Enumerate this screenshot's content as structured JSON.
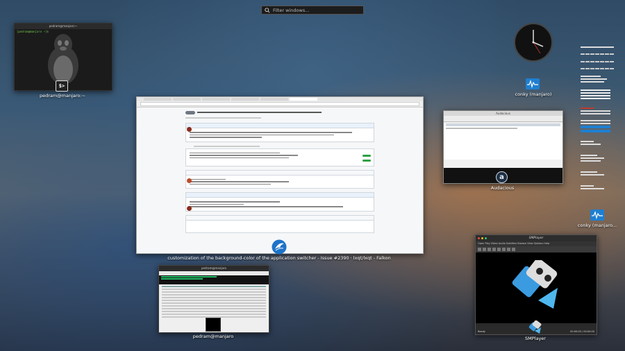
{
  "search": {
    "placeholder": "Filter windows..."
  },
  "windows": {
    "terminal_top": {
      "title": "pedram@manjaro:~",
      "prompt": "[pedram@manjaro ~]$",
      "caption": "pedram@manjaro:~",
      "icon": "terminal-icon"
    },
    "falkon": {
      "title": "customization of the background-color of the application switcher · Issue #2390 · lxqt/lxqt - Falkon",
      "caption": "customization of the background-color of the application switcher - Issue #2390 · lxqt/lxqt - Falkon",
      "icon": "falkon-icon"
    },
    "audacious": {
      "title": "Audacious",
      "caption": "Audacious",
      "icon": "audacious-icon",
      "icon_letter": "a"
    },
    "smplayer": {
      "title": "SMPlayer",
      "caption": "SMPlayer",
      "menu": "Open  Play  Video  Audio  Subtitles  Browse  View  Options  Help",
      "status": "Ready",
      "time": "00:00:00 / 00:00:00",
      "icon": "smplayer-icon"
    },
    "htop": {
      "title": "pedram@manjaro",
      "caption": "pedram@manjaro",
      "icon": "terminal-icon"
    },
    "conky_clock": {
      "caption": "conky (manjaro)",
      "icon": "conky-icon"
    },
    "conky_panel": {
      "caption": "conky (manjaro...",
      "icon": "conky-icon"
    }
  },
  "colors": {
    "accent": "#1f7fd1",
    "terminal_green": "#6ec24d",
    "search_bg": "#1c1c1c"
  }
}
